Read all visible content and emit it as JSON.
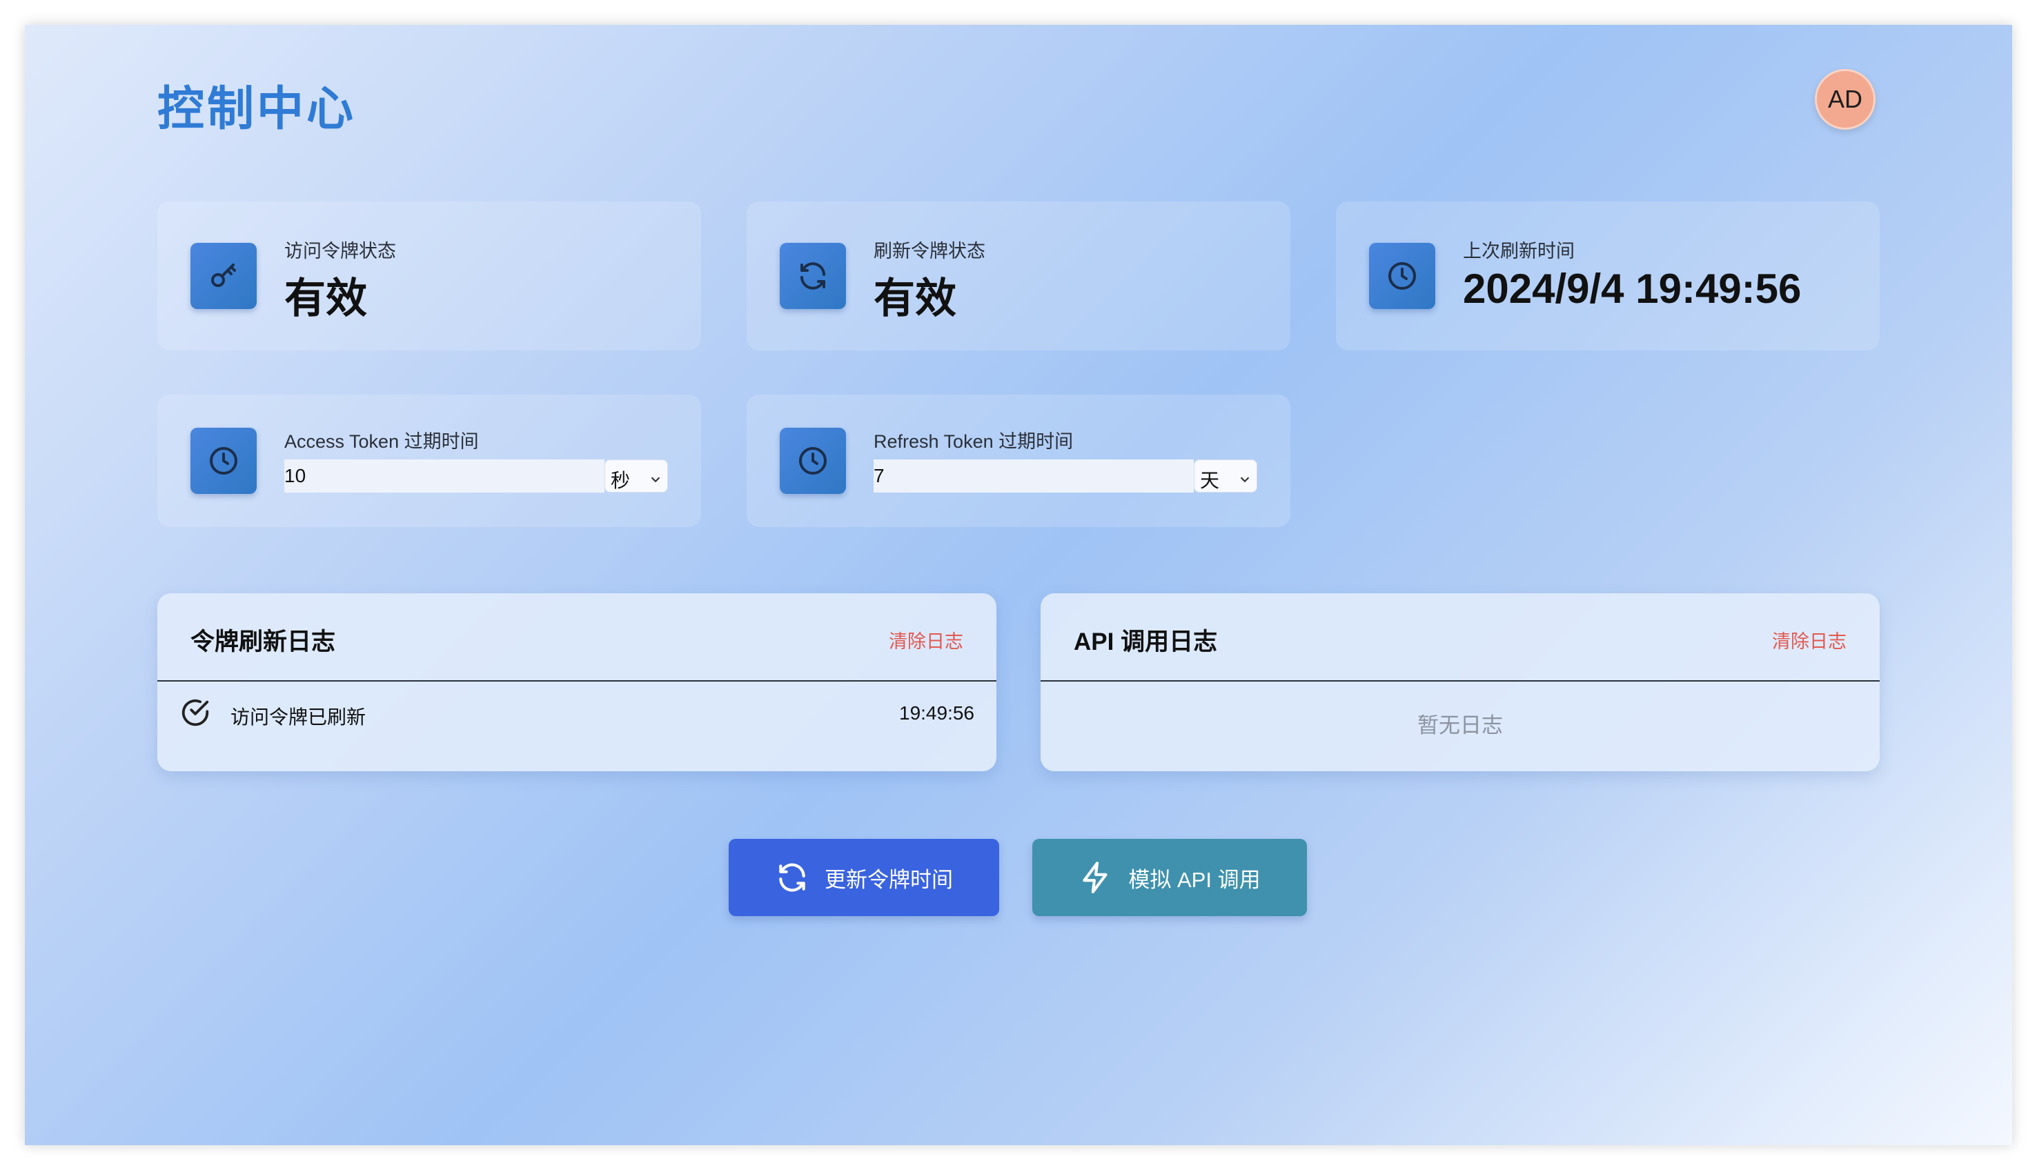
{
  "header": {
    "title": "控制中心",
    "avatar_initials": "AD"
  },
  "stats": [
    {
      "label": "访问令牌状态",
      "value": "有效",
      "icon": "key-icon"
    },
    {
      "label": "刷新令牌状态",
      "value": "有效",
      "icon": "refresh-icon"
    },
    {
      "label": "上次刷新时间",
      "value": "2024/9/4 19:49:56",
      "icon": "clock-icon"
    }
  ],
  "settings": [
    {
      "label": "Access Token 过期时间",
      "value": "10",
      "unit": "秒",
      "icon": "clock-icon"
    },
    {
      "label": "Refresh Token 过期时间",
      "value": "7",
      "unit": "天",
      "icon": "clock-icon"
    }
  ],
  "logs": {
    "token": {
      "title": "令牌刷新日志",
      "clear_label": "清除日志",
      "entries": [
        {
          "text": "访问令牌已刷新",
          "time": "19:49:56",
          "icon": "check-circle-icon"
        }
      ]
    },
    "api": {
      "title": "API 调用日志",
      "clear_label": "清除日志",
      "empty_text": "暂无日志"
    }
  },
  "actions": {
    "update_label": "更新令牌时间",
    "simulate_label": "模拟 API 调用"
  },
  "colors": {
    "title": "#2f7bd5",
    "primary_button": "#3a63e0",
    "secondary_button": "#3f91ad",
    "danger_text": "#e3584f",
    "avatar_bg": "#f2a98f"
  }
}
